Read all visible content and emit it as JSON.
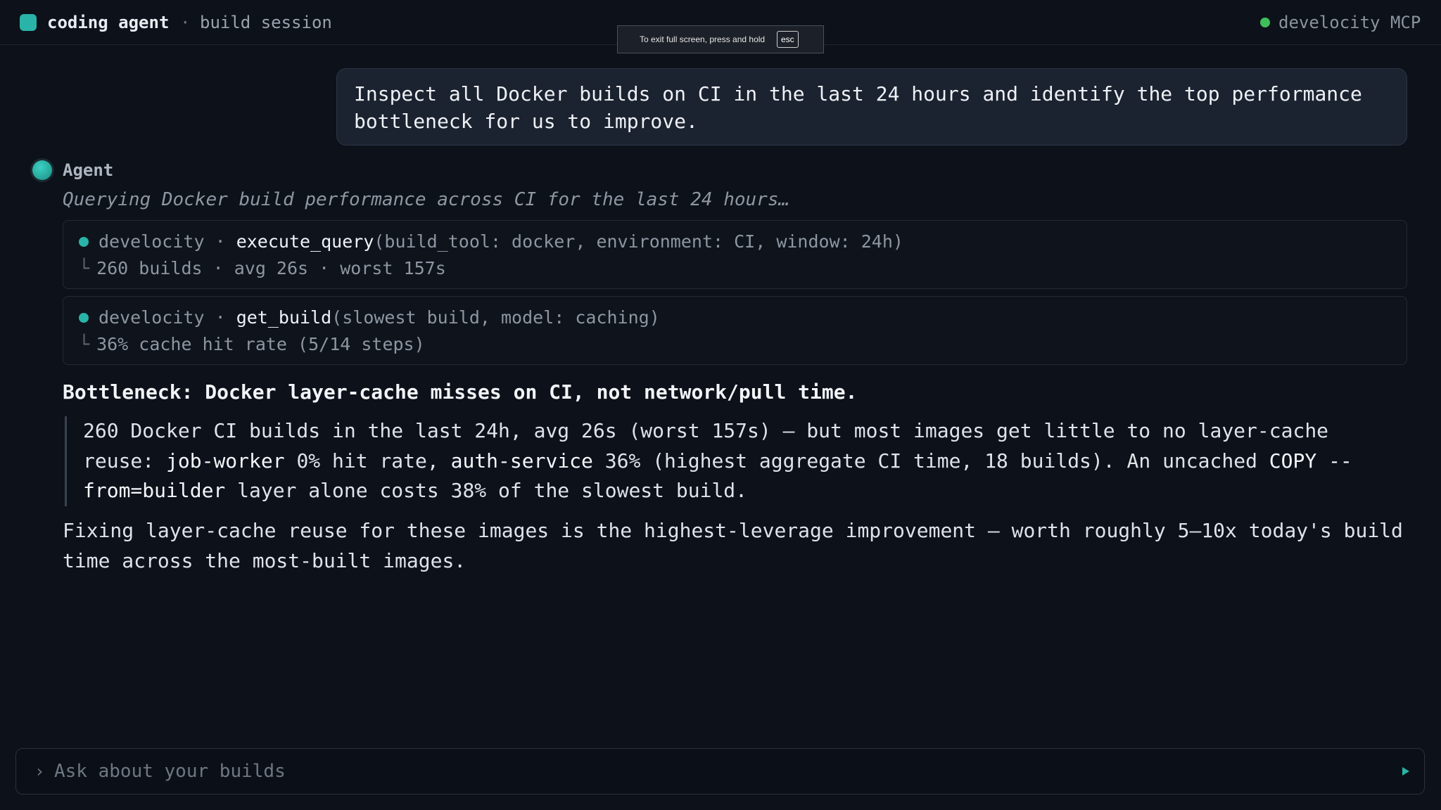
{
  "header": {
    "app_name": "coding agent",
    "separator": "·",
    "session_label": "build session",
    "mcp_label": "develocity MCP"
  },
  "overlay": {
    "fullscreen_text": "To exit full screen, press and hold",
    "fullscreen_key": "esc"
  },
  "user_message": "Inspect all Docker builds on CI in the last 24 hours and identify the top performance bottleneck for us to improve.",
  "agent": {
    "name": "Agent",
    "status": "Querying Docker build performance across CI for the last 24 hours…"
  },
  "tool_calls": [
    {
      "server": "develocity",
      "separator": "·",
      "function": "execute_query",
      "args": "(build_tool: docker, environment: CI, window: 24h)",
      "result_prefix": "└",
      "result": "260 builds · avg 26s · worst 157s"
    },
    {
      "server": "develocity",
      "separator": "·",
      "function": "get_build",
      "args": "(slowest build, model: caching)",
      "result_prefix": "└",
      "result": "36% cache hit rate (5/14 steps)"
    }
  ],
  "answer": {
    "headline": "Bottleneck: Docker layer-cache misses on CI, not network/pull time.",
    "quote_parts": {
      "p1": "260 Docker CI builds in the last 24h, avg 26s (worst 157s) — but most images get little to no layer-cache reuse: ",
      "image1": "job-worker",
      "p2": " 0% hit rate, ",
      "image2": "auth-service",
      "p3": " 36% (highest aggregate CI time, 18 builds). An uncached ",
      "instruction": "COPY --from=builder",
      "p4": " layer alone costs 38% of the slowest build."
    },
    "recommendation": "Fixing layer-cache reuse for these images is the highest-leverage improvement — worth roughly 5–10x today's build time across the most-built images."
  },
  "composer": {
    "prompt_symbol": "›",
    "placeholder": "Ask about your builds"
  },
  "colors": {
    "background": "#0c111a",
    "accent": "#2ab3a8",
    "mcp_status": "#3fbf5a",
    "user_bubble": "#1c2330"
  }
}
